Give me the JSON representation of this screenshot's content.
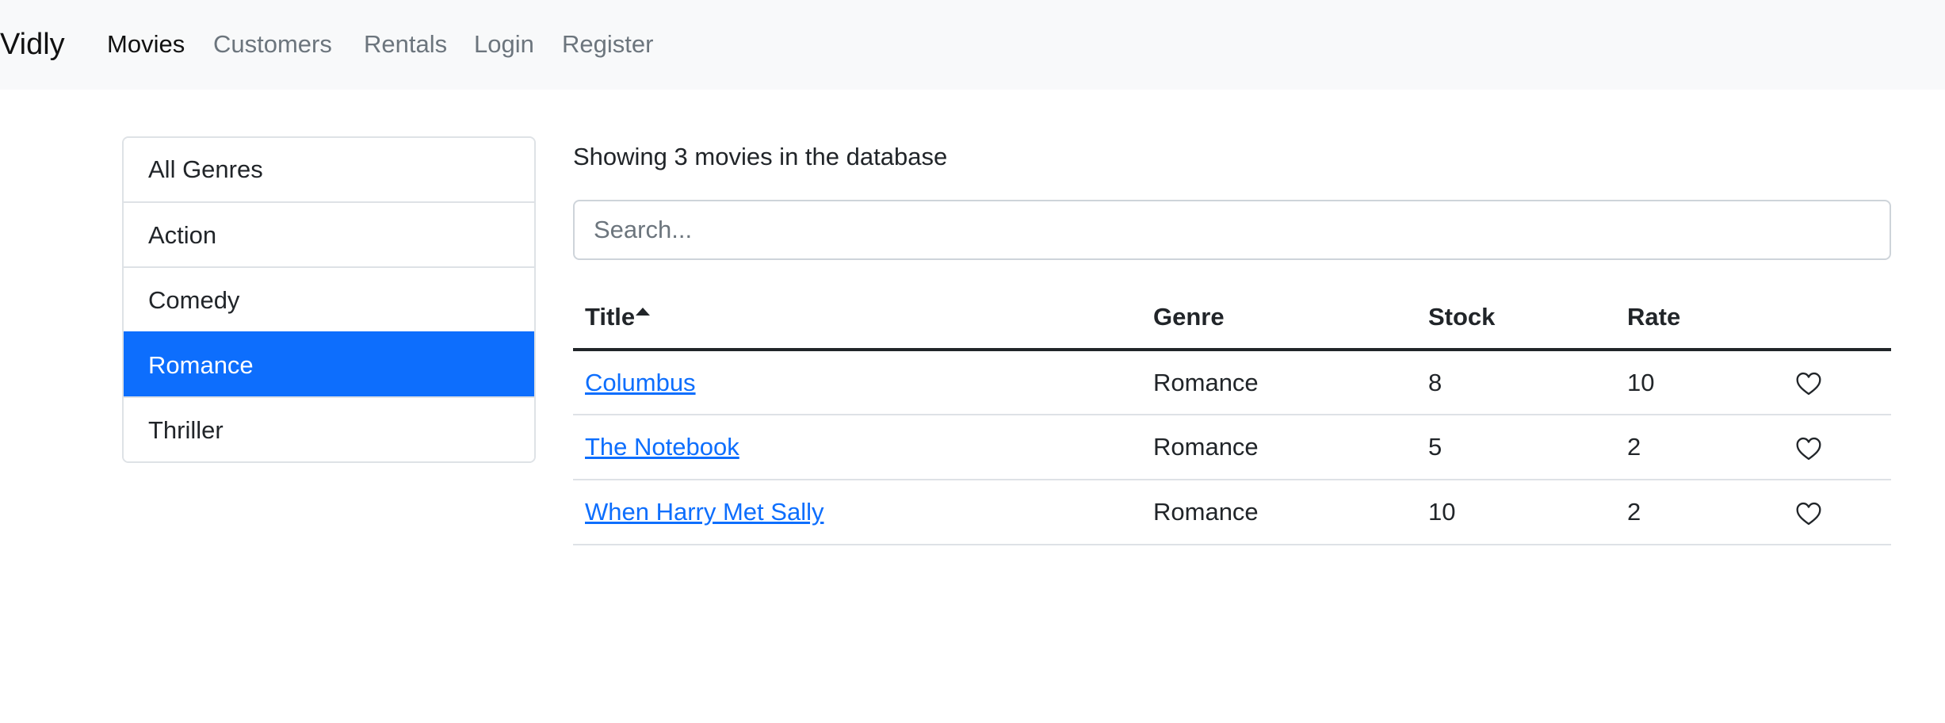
{
  "navbar": {
    "brand": "Vidly",
    "links": [
      {
        "label": "Movies",
        "active": true
      },
      {
        "label": "Customers",
        "active": false
      },
      {
        "label": "Rentals",
        "active": false
      },
      {
        "label": "Login",
        "active": false
      },
      {
        "label": "Register",
        "active": false
      }
    ]
  },
  "sidebar": {
    "genres": [
      {
        "label": "All Genres",
        "active": false
      },
      {
        "label": "Action",
        "active": false
      },
      {
        "label": "Comedy",
        "active": false
      },
      {
        "label": "Romance",
        "active": true
      },
      {
        "label": "Thriller",
        "active": false
      }
    ]
  },
  "main": {
    "count_text": "Showing 3 movies in the database",
    "search": {
      "placeholder": "Search...",
      "value": ""
    },
    "table": {
      "columns": [
        "Title",
        "Genre",
        "Stock",
        "Rate"
      ],
      "sort": {
        "column": "Title",
        "order": "asc",
        "icon": "sort-asc-icon"
      },
      "rows": [
        {
          "title": "Columbus",
          "genre": "Romance",
          "stock": "8",
          "rate": "10",
          "liked": false,
          "icon": "heart-outline-icon"
        },
        {
          "title": "The Notebook",
          "genre": "Romance",
          "stock": "5",
          "rate": "2",
          "liked": false,
          "icon": "heart-outline-icon"
        },
        {
          "title": "When Harry Met Sally",
          "genre": "Romance",
          "stock": "10",
          "rate": "2",
          "liked": false,
          "icon": "heart-outline-icon"
        }
      ]
    }
  },
  "colors": {
    "accent": "#0d6efd",
    "navbar_bg": "#f8f9fa",
    "muted_text": "#6c757d",
    "border": "#dee2e6"
  }
}
